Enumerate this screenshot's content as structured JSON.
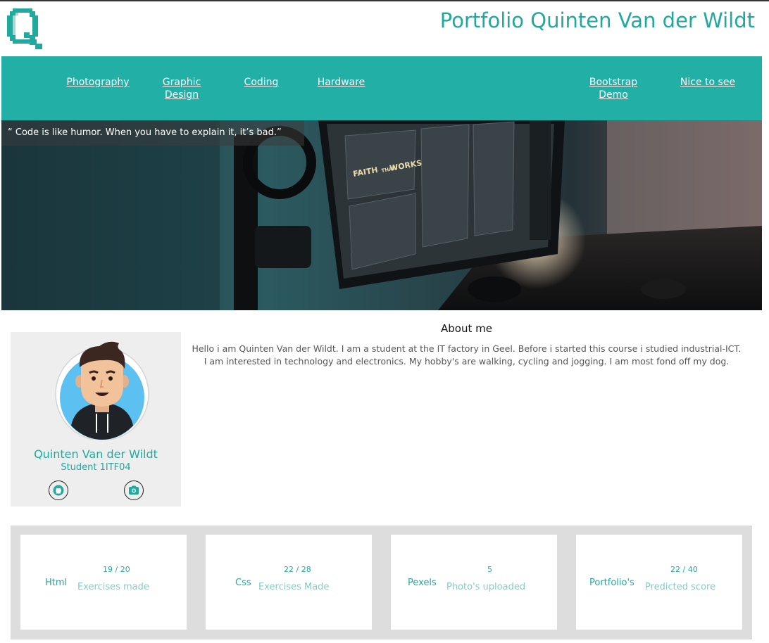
{
  "header": {
    "logo_letter": "Q",
    "title": "Portfolio Quinten Van der Wildt"
  },
  "nav": {
    "items": [
      {
        "label": "Photography"
      },
      {
        "label": "Graphic Design"
      },
      {
        "label": "Coding"
      },
      {
        "label": "Hardware"
      },
      {
        "label": "Bootstrap Demo"
      },
      {
        "label": "Nice to see"
      }
    ]
  },
  "hero": {
    "quote": "“ Code is like humor. When you have to explain it, it’s bad.”",
    "screen_text": [
      "FAITH",
      "THAT",
      "WORKS"
    ]
  },
  "profile": {
    "name": "Quinten Van der Wildt",
    "role": "Student 1ITF04",
    "links": [
      {
        "icon": "github-icon"
      },
      {
        "icon": "camera-icon"
      }
    ]
  },
  "about": {
    "title": "About me",
    "text": "Hello i am Quinten Van der Wildt. I am a student at the IT factory in Geel. Before i started this course i studied industrial-ICT. I am interested in technology and electronics. My hobby's are walking, cycling and jogging. I am most fond off my dog."
  },
  "stats": [
    {
      "label": "Html",
      "value": "19 / 20",
      "desc": "Exercises made"
    },
    {
      "label": "Css",
      "value": "22 / 28",
      "desc": "Exercises Made"
    },
    {
      "label": "Pexels",
      "value": "5",
      "desc": "Photo's uploaded"
    },
    {
      "label": "Portfolio's",
      "value": "22 / 40",
      "desc": "Predicted score"
    }
  ],
  "colors": {
    "accent": "#22b0a6",
    "accent_text": "#22a99e",
    "card_bg": "#eeeeee",
    "stats_bg": "#dddddd"
  }
}
